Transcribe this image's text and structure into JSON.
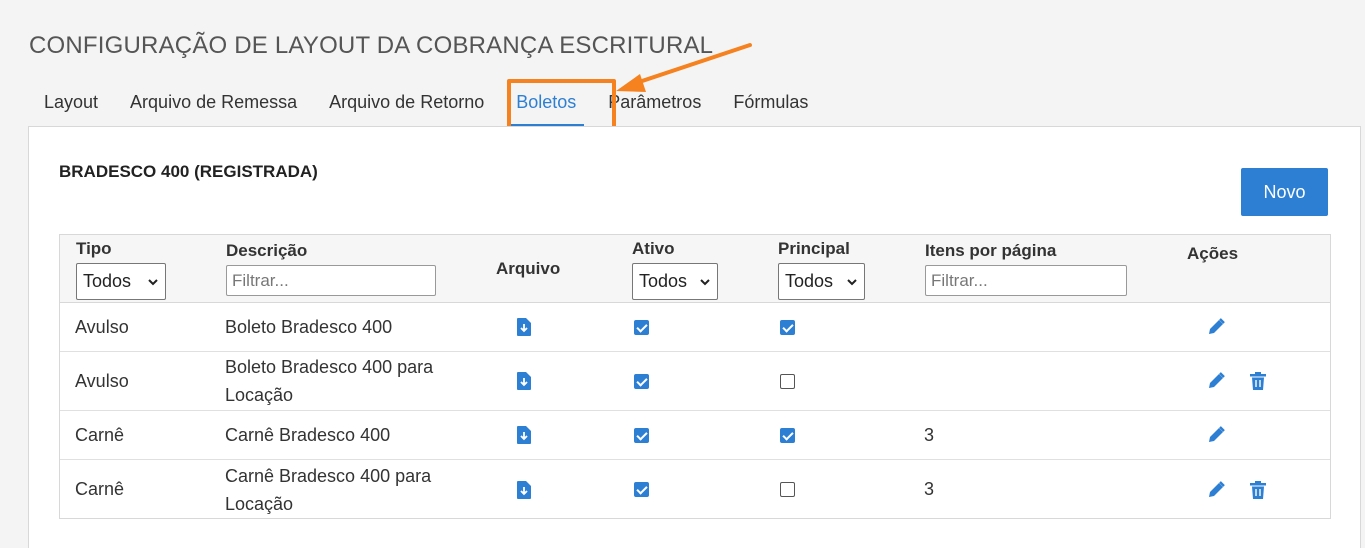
{
  "page": {
    "title": "CONFIGURAÇÃO DE LAYOUT DA COBRANÇA ESCRITURAL"
  },
  "tabs": [
    {
      "label": "Layout"
    },
    {
      "label": "Arquivo de Remessa"
    },
    {
      "label": "Arquivo de Retorno"
    },
    {
      "label": "Boletos"
    },
    {
      "label": "Parâmetros"
    },
    {
      "label": "Fórmulas"
    }
  ],
  "active_tab": "Boletos",
  "section": {
    "title": "BRADESCO 400 (REGISTRADA)",
    "new_button_label": "Novo"
  },
  "table": {
    "columns": {
      "tipo": "Tipo",
      "descricao": "Descrição",
      "arquivo": "Arquivo",
      "ativo": "Ativo",
      "principal": "Principal",
      "itens": "Itens por página",
      "acoes": "Ações"
    },
    "filters": {
      "tipo_value": "Todos",
      "descricao_placeholder": "Filtrar...",
      "ativo_value": "Todos",
      "principal_value": "Todos",
      "itens_placeholder": "Filtrar..."
    },
    "rows": [
      {
        "tipo": "Avulso",
        "descricao": "Boleto Bradesco 400",
        "ativo": true,
        "principal": true,
        "itens": "",
        "can_delete": false
      },
      {
        "tipo": "Avulso",
        "descricao": "Boleto Bradesco 400 para Locação",
        "ativo": true,
        "principal": false,
        "itens": "",
        "can_delete": true
      },
      {
        "tipo": "Carnê",
        "descricao": "Carnê Bradesco 400",
        "ativo": true,
        "principal": true,
        "itens": "3",
        "can_delete": false
      },
      {
        "tipo": "Carnê",
        "descricao": "Carnê Bradesco 400 para Locação",
        "ativo": true,
        "principal": false,
        "itens": "3",
        "can_delete": true
      }
    ]
  },
  "colors": {
    "accent": "#2d7fd3",
    "highlight": "#f5821f"
  },
  "icons": {
    "download": "file-download-icon",
    "edit": "pencil-icon",
    "delete": "trash-icon",
    "dropdown": "chevron-down-icon"
  }
}
